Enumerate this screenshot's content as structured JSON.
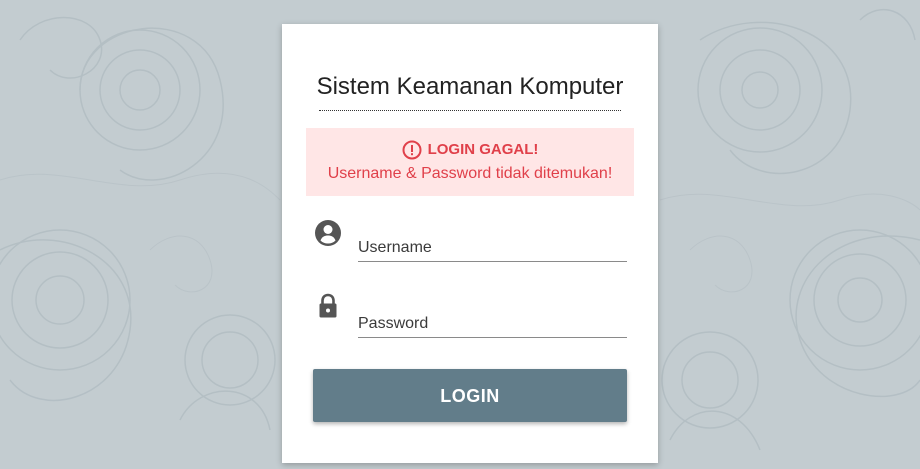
{
  "page": {
    "background_color": "#c3ccd0"
  },
  "card": {
    "title": "Sistem Keamanan Komputer"
  },
  "alert": {
    "icon": "exclamation-circle-icon",
    "heading": "LOGIN GAGAL!",
    "message": "Username & Password tidak ditemukan!",
    "background_color": "#ffe6e6",
    "text_color": "#e0404a"
  },
  "form": {
    "username": {
      "icon": "account-circle-icon",
      "placeholder": "Username",
      "value": ""
    },
    "password": {
      "icon": "lock-icon",
      "placeholder": "Password",
      "value": ""
    },
    "submit_label": "LOGIN",
    "submit_color": "#627d8a"
  }
}
